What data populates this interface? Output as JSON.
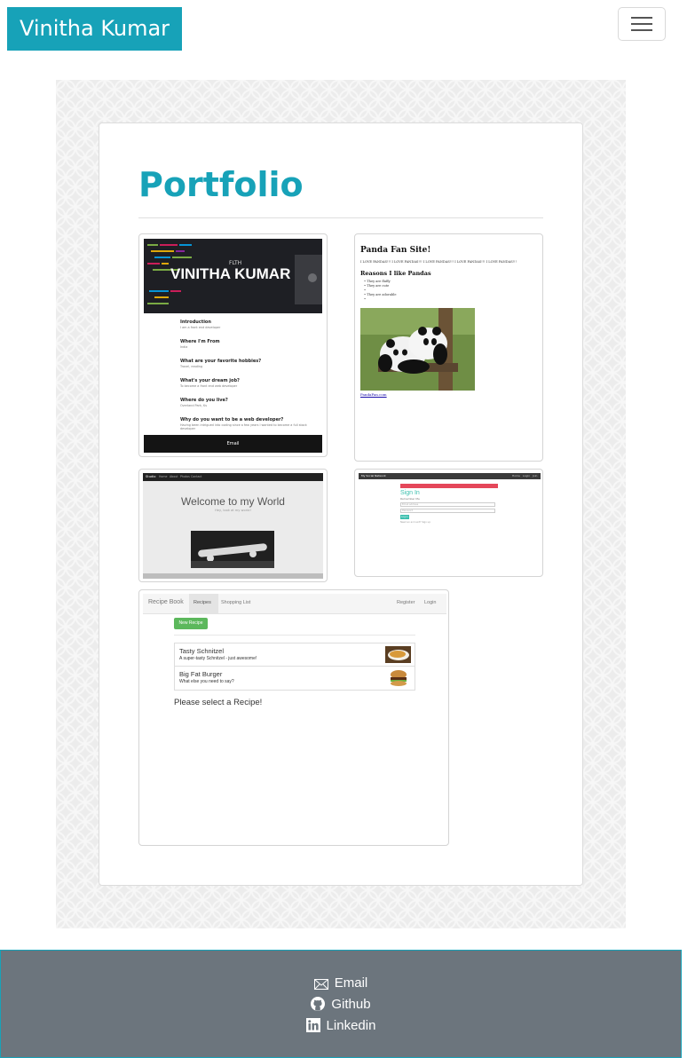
{
  "navbar": {
    "brand": "Vinitha Kumar",
    "toggler_icon": "hamburger-icon"
  },
  "main": {
    "title": "Portfolio",
    "projects": [
      {
        "name": "about-me-site",
        "banner_small": "FLTH",
        "banner_title": "VINITHA KUMAR",
        "sections": [
          {
            "q": "Introduction",
            "a": "I am a front end developer"
          },
          {
            "q": "Where I'm From",
            "a": "India"
          },
          {
            "q": "What are your favorite hobbies?",
            "a": "Travel, reading"
          },
          {
            "q": "What's your dream job?",
            "a": "To become a front end web developer"
          },
          {
            "q": "Where do you live?",
            "a": "Overland Park, Ks"
          },
          {
            "q": "Why do you want to be a web developer?",
            "a": "Having been intrigued into coding since a few years I wanted to become a full stack developer"
          }
        ],
        "footer_button": "Email"
      },
      {
        "name": "panda-fan-site",
        "heading": "Panda Fan Site!",
        "love_line": "I LOVE PANDAS!!! I LOVE PANDAS!!! I LOVE PANDAS!!! I LOVE PANDAS!!! I LOVE PANDAS!!!",
        "subheading": "Reasons I like Pandas",
        "reasons": [
          "They are fluffy",
          "They are cute",
          "",
          "They are adorable",
          ""
        ],
        "link": "PandaFan.com"
      },
      {
        "name": "welcome-site",
        "nav_brand": "Studio",
        "nav_links": [
          "Home",
          "About",
          "Photos",
          "Contact"
        ],
        "heading": "Welcome to my World",
        "subheading": "Hey, look at my world!"
      },
      {
        "name": "sign-in-app",
        "nav_brand": "My Social Network",
        "nav_links": [
          "Home",
          "Login",
          "Join"
        ],
        "heading": "Sign In",
        "remember": "Remember Me",
        "field_1": "Email address",
        "field_2": "Password",
        "button": "Log in",
        "link": "Need an account? Sign up"
      },
      {
        "name": "recipe-book",
        "nav_brand": "Recipe Book",
        "nav_links": [
          "Recipes",
          "Shopping List"
        ],
        "nav_right": [
          "Register",
          "Login"
        ],
        "new_button": "New Recipe",
        "recipes": [
          {
            "name": "Tasty Schnitzel",
            "desc": "A super-tasty Schnitzel - just awesome!"
          },
          {
            "name": "Big Fat Burger",
            "desc": "What else you need to say?"
          }
        ],
        "prompt": "Please select a Recipe!"
      }
    ]
  },
  "footer": {
    "links": [
      {
        "label": "Email",
        "icon": "envelope-icon"
      },
      {
        "label": "Github",
        "icon": "github-icon"
      },
      {
        "label": "Linkedin",
        "icon": "linkedin-icon"
      }
    ]
  },
  "colors": {
    "accent": "#17a2b8",
    "footer_bg": "#6c757d",
    "recipe_green": "#5cb85c",
    "signin_red": "#e5475a",
    "signin_teal": "#3cbfae"
  }
}
